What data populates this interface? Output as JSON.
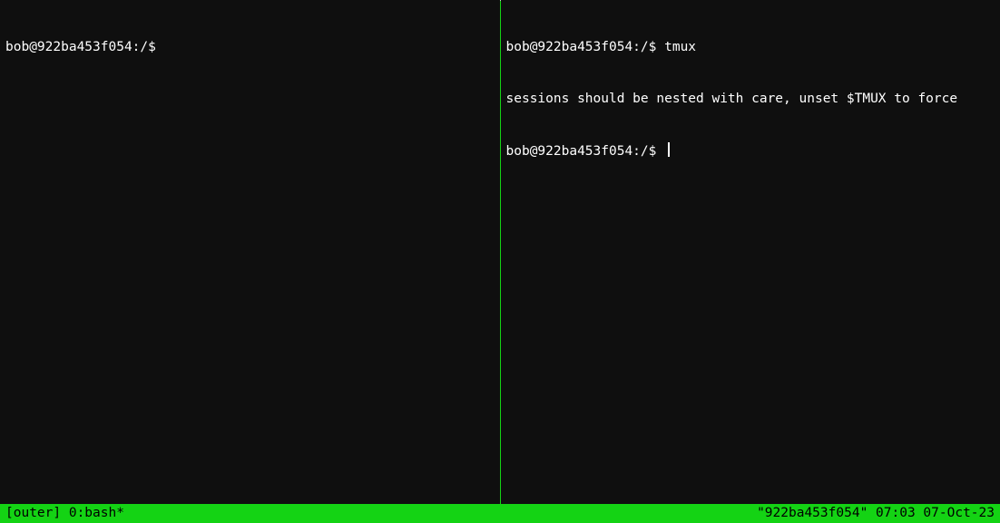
{
  "left_pane": {
    "lines": [
      {
        "prompt": "bob@922ba453f054:/$ ",
        "cmd": ""
      }
    ]
  },
  "right_pane": {
    "lines": [
      {
        "prompt": "bob@922ba453f054:/$ ",
        "cmd": "tmux"
      },
      {
        "text": "sessions should be nested with care, unset $TMUX to force"
      },
      {
        "prompt": "bob@922ba453f054:/$ ",
        "cmd": "",
        "cursor": true
      }
    ]
  },
  "status": {
    "session": "[outer] ",
    "window": "0:bash*",
    "host": "\"922ba453f054\"",
    "time": "07:03",
    "date": "07-Oct-23"
  }
}
